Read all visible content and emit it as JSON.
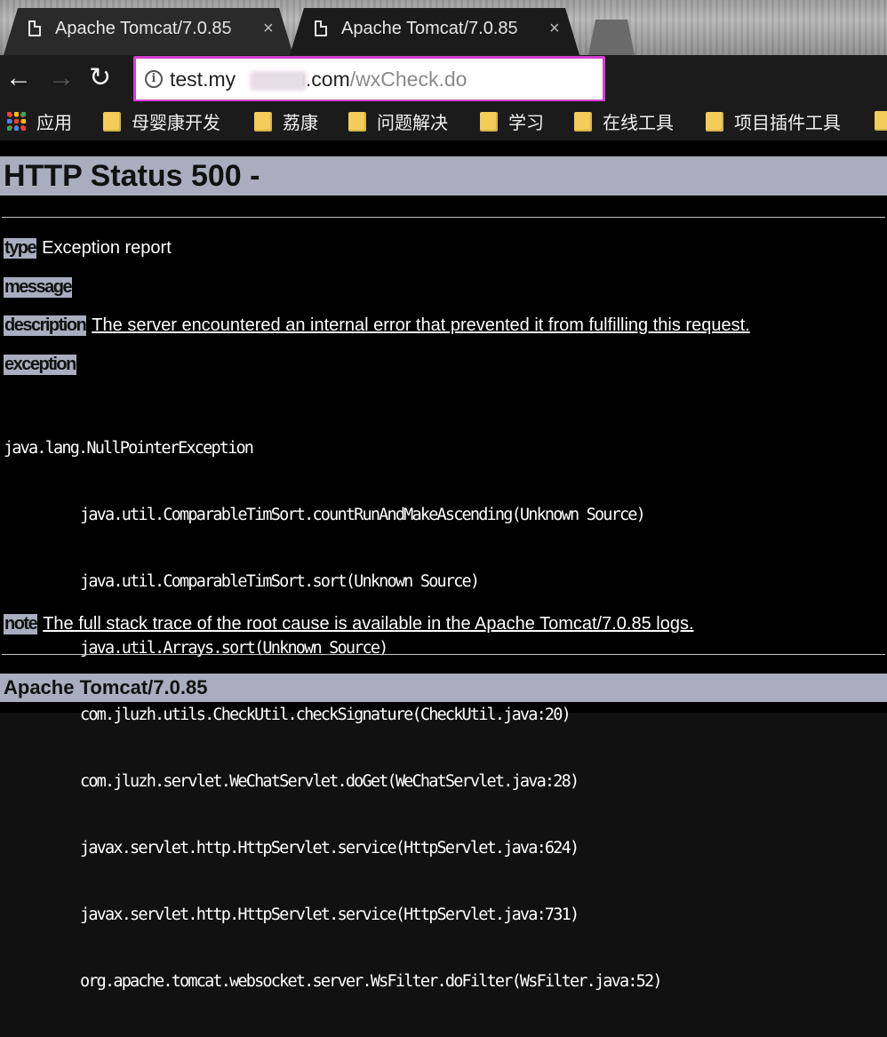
{
  "tabs": [
    {
      "title": "Apache Tomcat/7.0.85",
      "close": "×"
    },
    {
      "title": "Apache Tomcat/7.0.85",
      "close": "×"
    }
  ],
  "toolbar": {
    "back_icon": "←",
    "forward_icon": "→",
    "reload_icon": "↻",
    "info_icon": "i",
    "url_host_start": "test.my",
    "url_host_end": "u.com",
    "url_path": "/wxCheck.do",
    "omnibox_highlight_color": "#d23fce"
  },
  "bookmarks": [
    {
      "icon": "apps-icon",
      "label": "应用"
    },
    {
      "icon": "folder-icon",
      "label": "母婴康开发"
    },
    {
      "icon": "folder-icon",
      "label": "荔康"
    },
    {
      "icon": "folder-icon",
      "label": "问题解决"
    },
    {
      "icon": "folder-icon",
      "label": "学习"
    },
    {
      "icon": "folder-icon",
      "label": "在线工具"
    },
    {
      "icon": "folder-icon",
      "label": "项目插件工具"
    }
  ],
  "page": {
    "title": "HTTP Status 500 -",
    "type_label": "type",
    "type_value": "Exception report",
    "message_label": "message",
    "description_label": "description",
    "description_value": "The server encountered an internal error that prevented it from fulfilling this request.",
    "exception_label": "exception",
    "stack_trace": [
      "java.lang.NullPointerException",
      "\tjava.util.ComparableTimSort.countRunAndMakeAscending(Unknown Source)",
      "\tjava.util.ComparableTimSort.sort(Unknown Source)",
      "\tjava.util.Arrays.sort(Unknown Source)",
      "\tcom.jluzh.utils.CheckUtil.checkSignature(CheckUtil.java:20)",
      "\tcom.jluzh.servlet.WeChatServlet.doGet(WeChatServlet.java:28)",
      "\tjavax.servlet.http.HttpServlet.service(HttpServlet.java:624)",
      "\tjavax.servlet.http.HttpServlet.service(HttpServlet.java:731)",
      "\torg.apache.tomcat.websocket.server.WsFilter.doFilter(WsFilter.java:52)"
    ],
    "note_label": "note",
    "note_value": "The full stack trace of the root cause is available in the Apache Tomcat/7.0.85 logs.",
    "footer": "Apache Tomcat/7.0.85"
  }
}
